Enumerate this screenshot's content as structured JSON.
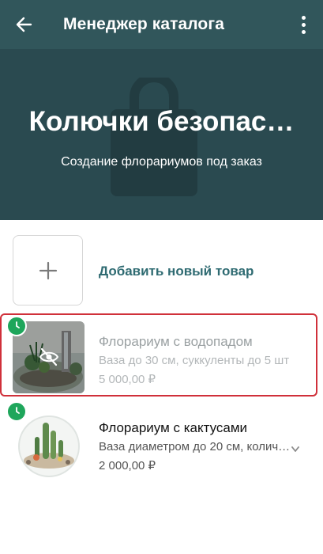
{
  "header": {
    "back_icon": "arrow-left-icon",
    "title": "Менеджер каталога",
    "more_icon": "more-vertical-icon"
  },
  "hero": {
    "title": "Колючки безопас…",
    "subtitle": "Создание флорариумов под заказ"
  },
  "add_item": {
    "icon": "plus-icon",
    "label": "Добавить новый товар"
  },
  "products": [
    {
      "title": "Флорариум с водопадом",
      "description": "Ваза до 30 см, суккуленты до 5 шт",
      "price": "5 000,00 ₽",
      "status_icon": "clock-icon",
      "hidden": true,
      "hidden_icon": "eye-off-icon"
    },
    {
      "title": "Флорариум с кактусами",
      "description": "Ваза диаметром до 20 см, колич…",
      "price": "2 000,00 ₽",
      "status_icon": "clock-icon",
      "hidden": false,
      "more_icon": "chevron-down-icon"
    }
  ],
  "colors": {
    "toolbar": "#31565b",
    "hero": "#2a4a50",
    "accent": "#2f6b72",
    "status_green": "#1ea65b",
    "highlight": "#d0303a"
  }
}
